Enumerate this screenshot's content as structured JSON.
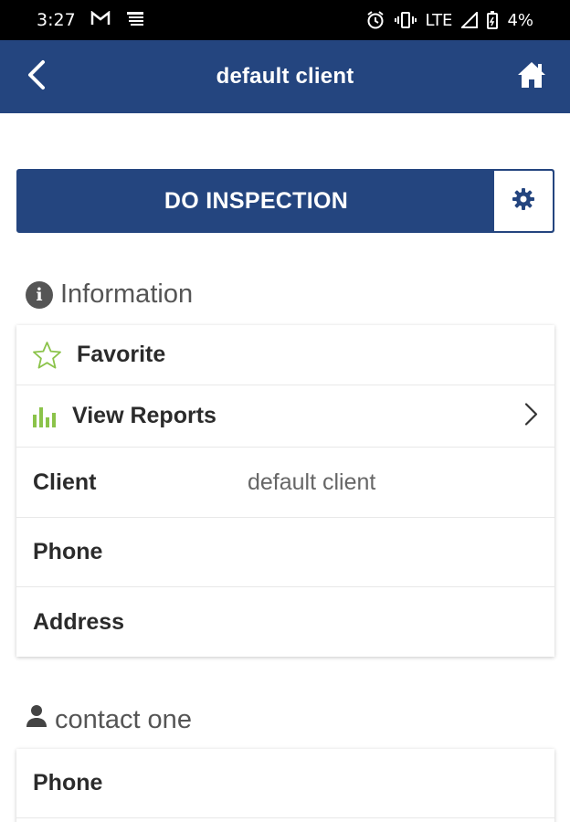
{
  "status_bar": {
    "time": "3:27",
    "network": "LTE",
    "battery": "4%",
    "icons": [
      "gmail-icon",
      "notification-icon",
      "alarm-icon",
      "vibrate-icon",
      "signal-icon",
      "battery-icon"
    ]
  },
  "app_bar": {
    "title": "default client",
    "back_icon": "chevron-left-icon",
    "home_icon": "home-icon"
  },
  "actions": {
    "do_inspection": "DO INSPECTION",
    "settings_icon": "gear-icon"
  },
  "information": {
    "title": "Information",
    "rows": [
      {
        "label": "Favorite",
        "icon": "star-outline-icon"
      },
      {
        "label": "View Reports",
        "icon": "bar-chart-icon"
      },
      {
        "label": "Client",
        "value": "default client"
      },
      {
        "label": "Phone",
        "value": ""
      },
      {
        "label": "Address",
        "value": ""
      }
    ]
  },
  "contact": {
    "title": "contact one",
    "rows": [
      {
        "label": "Phone",
        "value": ""
      }
    ]
  },
  "colors": {
    "primary": "#24457f",
    "accent_green": "#8bc34a",
    "text_dark": "#2b2b2b",
    "text_muted": "#666666"
  }
}
